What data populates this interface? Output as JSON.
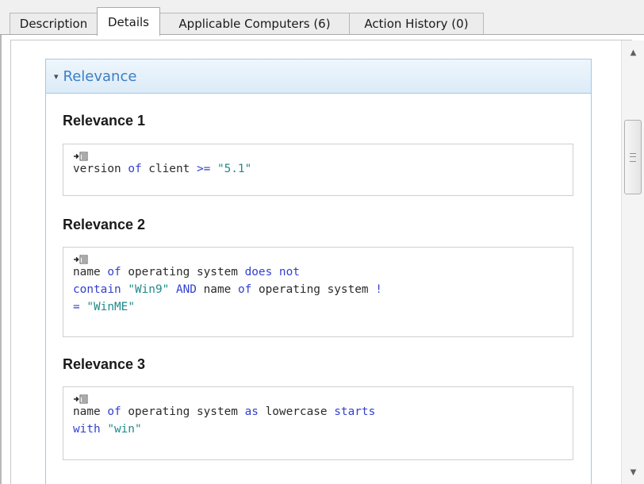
{
  "tabs": [
    {
      "label": "Description"
    },
    {
      "label": "Details"
    },
    {
      "label": "Applicable Computers (6)"
    },
    {
      "label": "Action History (0)"
    }
  ],
  "active_tab": "Details",
  "panel": {
    "title": "Relevance",
    "caret": "▾",
    "relevances": [
      {
        "title": "Relevance 1",
        "lines": [
          [
            {
              "t": "version ",
              "c": "plain"
            },
            {
              "t": "of",
              "c": "kw"
            },
            {
              "t": " client ",
              "c": "plain"
            },
            {
              "t": ">=",
              "c": "kw"
            },
            {
              "t": " \"5.1\"",
              "c": "str"
            }
          ]
        ]
      },
      {
        "title": "Relevance 2",
        "lines": [
          [
            {
              "t": "name ",
              "c": "plain"
            },
            {
              "t": "of",
              "c": "kw"
            },
            {
              "t": " operating system ",
              "c": "plain"
            },
            {
              "t": "does not",
              "c": "kw"
            }
          ],
          [
            {
              "t": "contain",
              "c": "kw"
            },
            {
              "t": " \"Win9\" ",
              "c": "str"
            },
            {
              "t": "AND",
              "c": "kw"
            },
            {
              "t": " name ",
              "c": "plain"
            },
            {
              "t": "of",
              "c": "kw"
            },
            {
              "t": " operating system ",
              "c": "plain"
            },
            {
              "t": "!",
              "c": "kw"
            }
          ],
          [
            {
              "t": "=",
              "c": "kw"
            },
            {
              "t": " \"WinME\"",
              "c": "str"
            }
          ]
        ]
      },
      {
        "title": "Relevance 3",
        "lines": [
          [
            {
              "t": "name ",
              "c": "plain"
            },
            {
              "t": "of",
              "c": "kw"
            },
            {
              "t": " operating system ",
              "c": "plain"
            },
            {
              "t": "as",
              "c": "kw"
            },
            {
              "t": " lowercase ",
              "c": "plain"
            },
            {
              "t": "starts",
              "c": "kw"
            }
          ],
          [
            {
              "t": "with",
              "c": "kw"
            },
            {
              "t": " \"win\"",
              "c": "str"
            }
          ]
        ]
      }
    ]
  },
  "icons": {
    "copy": "copy-to-clipboard-icon",
    "scroll_up": "scroll-up-arrow-icon",
    "scroll_down": "scroll-down-arrow-icon",
    "scroll_grip": "scroll-grip-icon"
  },
  "colors": {
    "keyword": "#3340d0",
    "string": "#1f8a8a",
    "panel_header_text": "#3b7fc4",
    "panel_border": "#9ccbe8"
  }
}
